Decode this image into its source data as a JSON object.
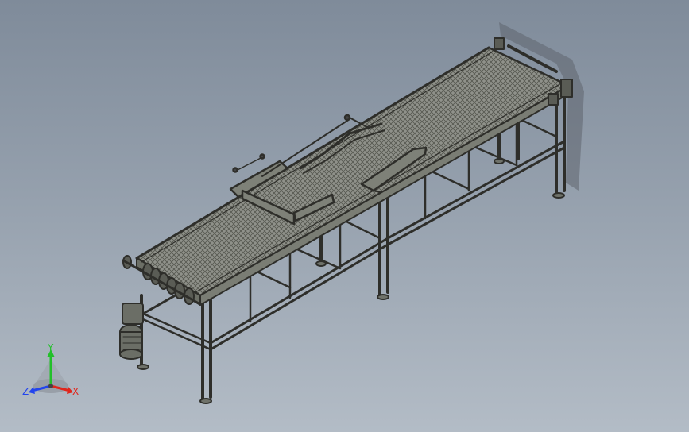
{
  "viewport": {
    "background_top": "#7f8b9a",
    "background_bottom": "#b3bcc6",
    "model_stroke": "#2e2e2a",
    "model_fill": "#8c8f86",
    "belt_fill": "#8f918a"
  },
  "triad": {
    "x_label": "X",
    "y_label": "Y",
    "z_label": "Z",
    "x_color": "#e0261c",
    "y_color": "#22c02a",
    "z_color": "#2244ee"
  },
  "icons": {
    "triad": "coordinate-triad-icon",
    "model": "belt-conveyor-assembly"
  }
}
